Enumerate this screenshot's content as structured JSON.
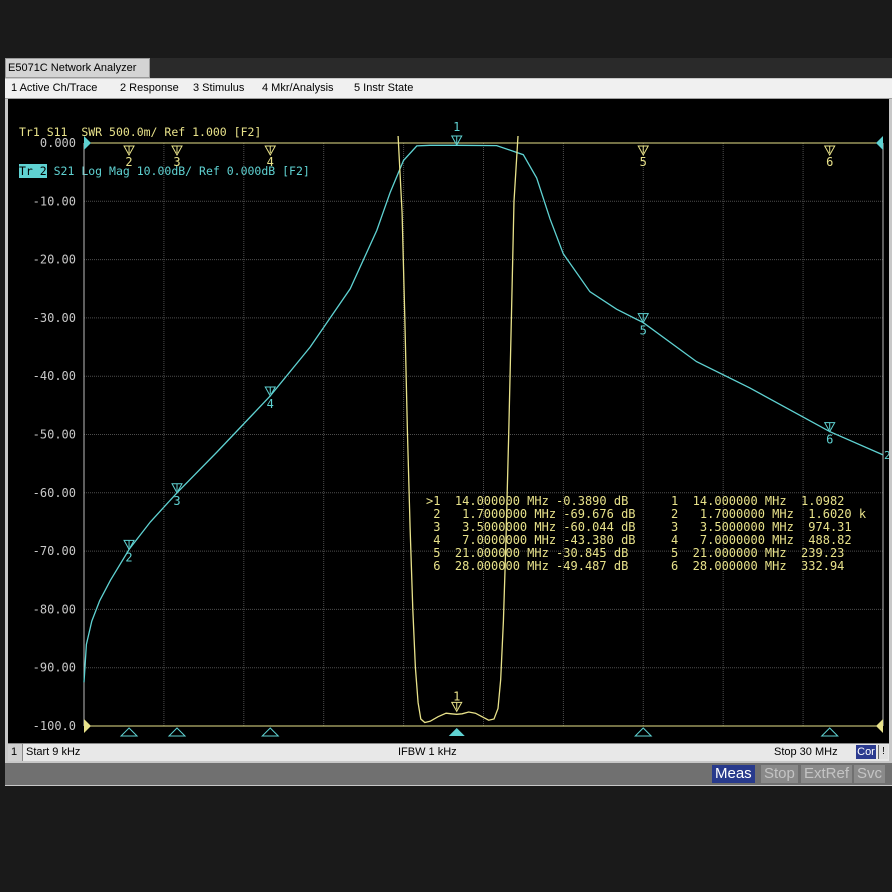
{
  "window": {
    "title": "E5071C Network Analyzer"
  },
  "menu": [
    "1 Active Ch/Trace",
    "2 Response",
    "3 Stimulus",
    "4 Mkr/Analysis",
    "5 Instr State"
  ],
  "traces": {
    "tr1": {
      "label": "Tr1",
      "text": " S11  SWR 500.0m/ Ref 1.000 [F2]",
      "color": "#e8e28a"
    },
    "tr2": {
      "label": "Tr 2",
      "text": " S21 Log Mag 10.00dB/ Ref 0.000dB [F2]",
      "color": "#5fd2d2"
    }
  },
  "chart_data": {
    "type": "line",
    "x_unit": "MHz",
    "xlim": [
      0.009,
      30
    ],
    "ylim": [
      -100,
      0
    ],
    "y_ticks": [
      "0.000",
      "-10.00",
      "-20.00",
      "-30.00",
      "-40.00",
      "-50.00",
      "-60.00",
      "-70.00",
      "-80.00",
      "-90.00",
      "-100.0"
    ],
    "grid": true,
    "series": [
      {
        "name": "S21 Log Mag",
        "color": "#5fd2d2",
        "x": [
          0.009,
          0.1,
          0.3,
          0.6,
          1.0,
          1.7,
          2.5,
          3.5,
          5.0,
          7.0,
          8.5,
          10.0,
          11.0,
          11.5,
          12.0,
          12.5,
          13.0,
          14.0,
          15.5,
          16.5,
          17.0,
          17.5,
          18.0,
          19.0,
          20.0,
          21.0,
          23.0,
          25.0,
          28.0,
          30.0
        ],
        "y": [
          -92.5,
          -86,
          -82,
          -78.5,
          -75,
          -69.7,
          -65,
          -60,
          -53,
          -43.4,
          -35,
          -25,
          -15,
          -8.5,
          -3,
          -0.5,
          -0.4,
          -0.39,
          -0.45,
          -2,
          -6,
          -13,
          -19,
          -25.5,
          -28.5,
          -30.8,
          -37.5,
          -42,
          -49.5,
          -53.5
        ]
      },
      {
        "name": "S11 SWR",
        "color": "#e8e28a",
        "x": [
          11.8,
          11.95,
          12.05,
          12.15,
          12.25,
          12.35,
          12.45,
          12.55,
          12.65,
          12.8,
          13.0,
          13.3,
          13.6,
          13.8,
          14.0,
          14.2,
          14.45,
          14.7,
          14.95,
          15.2,
          15.4,
          15.55,
          15.65,
          15.75,
          15.85,
          15.95,
          16.05,
          16.15,
          16.3
        ],
        "y": [
          1.2,
          -12,
          -30,
          -50,
          -66,
          -80,
          -90,
          -96,
          -98.8,
          -99.4,
          -99.2,
          -98.4,
          -97.8,
          -97.9,
          -98.0,
          -97.9,
          -97.6,
          -97.8,
          -98.4,
          -99.0,
          -98.8,
          -97,
          -92,
          -82,
          -68,
          -50,
          -30,
          -10,
          1.2
        ]
      }
    ],
    "stimulus_markers": [
      {
        "id": "1",
        "freq": 14.0
      },
      {
        "id": "2",
        "freq": 1.7
      },
      {
        "id": "3",
        "freq": 3.5
      },
      {
        "id": "4",
        "freq": 7.0
      },
      {
        "id": "5",
        "freq": 21.0
      },
      {
        "id": "6",
        "freq": 28.0
      }
    ]
  },
  "marker_table": {
    "s21": [
      ">1  14.000000 MHz -0.3890 dB",
      " 2   1.7000000 MHz -69.676 dB",
      " 3   3.5000000 MHz -60.044 dB",
      " 4   7.0000000 MHz -43.380 dB",
      " 5  21.000000 MHz -30.845 dB",
      " 6  28.000000 MHz -49.487 dB"
    ],
    "s11": [
      "1  14.000000 MHz  1.0982",
      "2   1.7000000 MHz  1.6020 k",
      "3   3.5000000 MHz  974.31",
      "4   7.0000000 MHz  488.82",
      "5  21.000000 MHz  239.23",
      "6  28.000000 MHz  332.94"
    ]
  },
  "status": {
    "channel": "1",
    "start": "Start 9 kHz",
    "ifbw": "IFBW 1 kHz",
    "stop": "Stop 30 MHz",
    "cor": "Cor",
    "excl": "!"
  },
  "softkeys": [
    {
      "label": "Meas",
      "active": true
    },
    {
      "label": "Stop",
      "active": false
    },
    {
      "label": "ExtRef",
      "active": false
    },
    {
      "label": "Svc",
      "active": false
    }
  ]
}
